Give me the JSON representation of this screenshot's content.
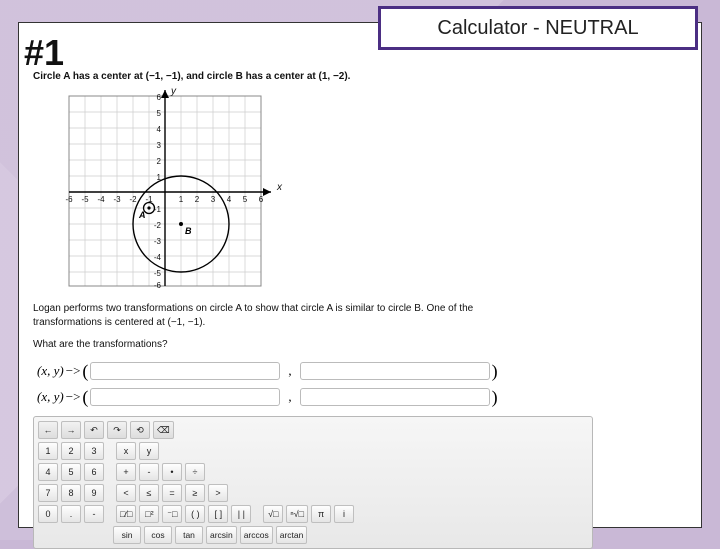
{
  "header": {
    "question_number": "#1",
    "calc_label": "Calculator - NEUTRAL"
  },
  "problem": {
    "intro": "Circle A has a center at (−1, −1), and circle B has a center at (1, −2).",
    "transform_text_a": "Logan performs two transformations on circle A to show that circle A is similar to circle B. One of the",
    "transform_text_b": "transformations is centered at (−1, −1).",
    "question": "What are the transformations?",
    "mapping_lhs": "(x, y) −> (",
    "paren_open": "(",
    "paren_close": ")",
    "comma": ",",
    "arrow": "−>"
  },
  "graph": {
    "x_label": "x",
    "y_label": "y",
    "x_ticks": [
      -6,
      -5,
      -4,
      -3,
      -2,
      -1,
      1,
      2,
      3,
      4,
      5,
      6
    ],
    "y_ticks": [
      6,
      5,
      4,
      3,
      2,
      1,
      -1,
      -2,
      -3,
      -4,
      -5,
      -6
    ],
    "circle_A": {
      "cx": -1,
      "cy": -1,
      "r": 0.35,
      "label": "A"
    },
    "circle_B": {
      "cx": 1,
      "cy": -2,
      "r": 3,
      "label": "B"
    }
  },
  "toolbar": {
    "nav": [
      "←",
      "→",
      "↶",
      "↷",
      "⟲",
      "⌫"
    ],
    "row1": [
      "1",
      "2",
      "3",
      "x",
      "y"
    ],
    "row2": [
      "4",
      "5",
      "6",
      "+",
      "-",
      "•",
      "÷"
    ],
    "row3": [
      "7",
      "8",
      "9",
      "<",
      "≤",
      "=",
      "≥",
      ">"
    ],
    "row4": [
      "0",
      ".",
      "-",
      "□⁄□",
      "□²",
      "⁻□",
      "( )",
      "[ ]",
      "| |",
      "√□",
      "ⁿ√□",
      "π",
      "i"
    ],
    "row5": [
      "sin",
      "cos",
      "tan",
      "arcsin",
      "arccos",
      "arctan"
    ]
  }
}
